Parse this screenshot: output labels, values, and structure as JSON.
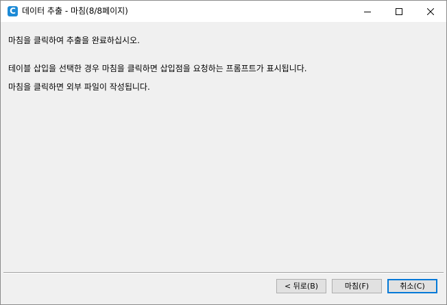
{
  "window": {
    "title": "데이터 추출 - 마침(8/8페이지)",
    "app_icon_letter": "C",
    "controls": {
      "minimize_icon": "minimize-icon",
      "maximize_icon": "maximize-icon",
      "close_icon": "close-icon"
    }
  },
  "content": {
    "line1": "마침을 클릭하여 추출을 완료하십시오.",
    "line2": "테이블 삽입을 선택한 경우 마침을 클릭하면 삽입점을 요청하는 프롬프트가 표시됩니다.",
    "line3": "마침을 클릭하면 외부 파일이 작성됩니다."
  },
  "buttons": {
    "back": "< 뒤로(B)",
    "finish": "마침(F)",
    "cancel": "취소(C)"
  },
  "colors": {
    "accent": "#0078d7",
    "app_icon": "#1c8ad6",
    "titlebar": "#ffffff",
    "body": "#f0f0f0"
  }
}
